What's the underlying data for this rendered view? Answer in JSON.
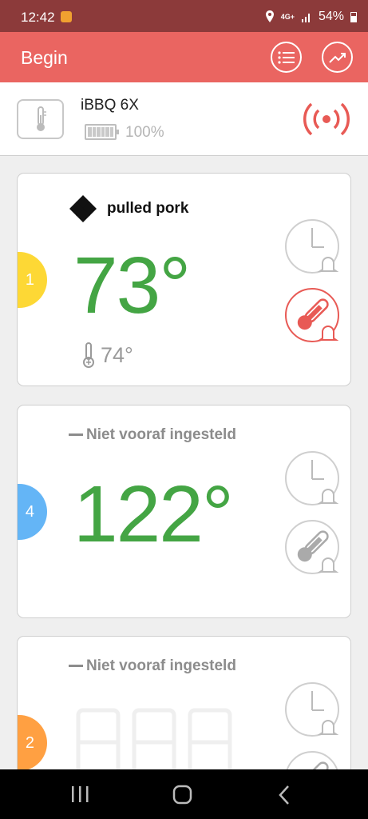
{
  "status_bar": {
    "time": "12:42",
    "network": "4G+",
    "battery": "54%"
  },
  "app_bar": {
    "title": "Begin"
  },
  "device": {
    "name": "iBBQ 6X",
    "battery_pct": "100%"
  },
  "probes": [
    {
      "number": "1",
      "color": "#fdd835",
      "label": "pulled pork",
      "temp": "73°",
      "target": "74°"
    },
    {
      "number": "4",
      "color": "#64b5f6",
      "label": "Niet vooraf ingesteld",
      "temp": "122°"
    },
    {
      "number": "2",
      "color": "#ffa042",
      "label": "Niet vooraf ingesteld"
    }
  ]
}
